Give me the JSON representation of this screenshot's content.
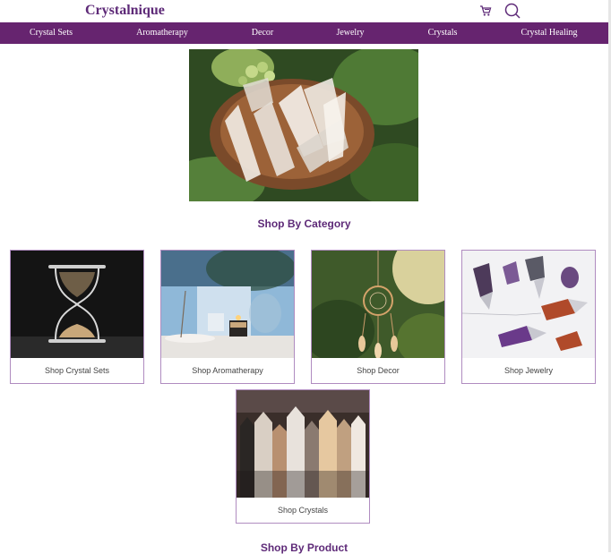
{
  "header": {
    "brand": "Crystalnique",
    "icons": {
      "cart": "cart-icon",
      "search": "search-icon"
    }
  },
  "nav": {
    "items": [
      {
        "label": "Crystal Sets"
      },
      {
        "label": "Aromatherapy"
      },
      {
        "label": "Decor"
      },
      {
        "label": "Jewelry"
      },
      {
        "label": "Crystals"
      },
      {
        "label": "Crystal Healing"
      }
    ]
  },
  "hero": {
    "image": "crystals-in-wooden-bowl"
  },
  "sections": {
    "category_title": "Shop By Category",
    "product_title": "Shop By Product"
  },
  "categories": [
    {
      "label": "Shop Crystal Sets",
      "image": "hourglass"
    },
    {
      "label": "Shop Aromatherapy",
      "image": "candle-and-incense"
    },
    {
      "label": "Shop Decor",
      "image": "dreamcatcher"
    },
    {
      "label": "Shop Jewelry",
      "image": "crystal-pendulums"
    },
    {
      "label": "Shop Crystals",
      "image": "crystal-points"
    }
  ],
  "colors": {
    "brand": "#5e2a78",
    "nav_bg": "#66246f",
    "card_border": "#b08cc0"
  }
}
